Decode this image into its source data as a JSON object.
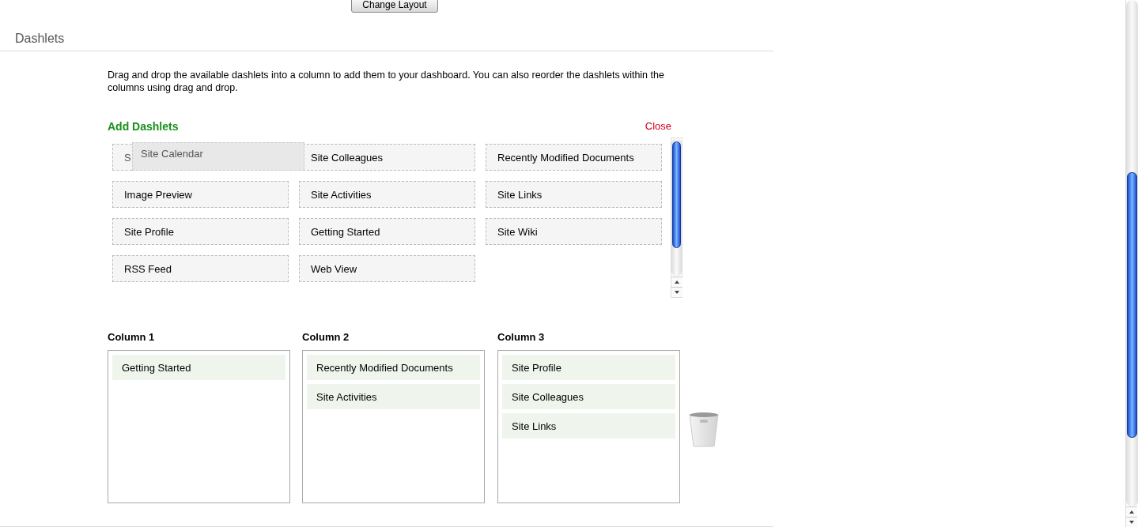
{
  "layout_button": "Change Layout",
  "section_title": "Dashlets",
  "description": "Drag and drop the available dashlets into a column to add them to your dashboard. You can also reorder the dashlets within the columns using drag and drop.",
  "add_dashlets": {
    "title": "Add Dashlets",
    "close": "Close",
    "items": [
      {
        "label": "S",
        "covered": true
      },
      {
        "label": "Site Colleagues"
      },
      {
        "label": "Recently Modified Documents"
      },
      {
        "label": "Image Preview"
      },
      {
        "label": "Site Activities"
      },
      {
        "label": "Site Links"
      },
      {
        "label": "Site Profile"
      },
      {
        "label": "Getting Started"
      },
      {
        "label": "Site Wiki"
      },
      {
        "label": "RSS Feed"
      },
      {
        "label": "Web View"
      }
    ],
    "dragging": {
      "label": "Site Calendar"
    }
  },
  "columns": [
    {
      "title": "Column 1",
      "items": [
        "Getting Started"
      ]
    },
    {
      "title": "Column 2",
      "items": [
        "Recently Modified Documents",
        "Site Activities"
      ]
    },
    {
      "title": "Column 3",
      "items": [
        "Site Profile",
        "Site Colleagues",
        "Site Links"
      ]
    }
  ]
}
